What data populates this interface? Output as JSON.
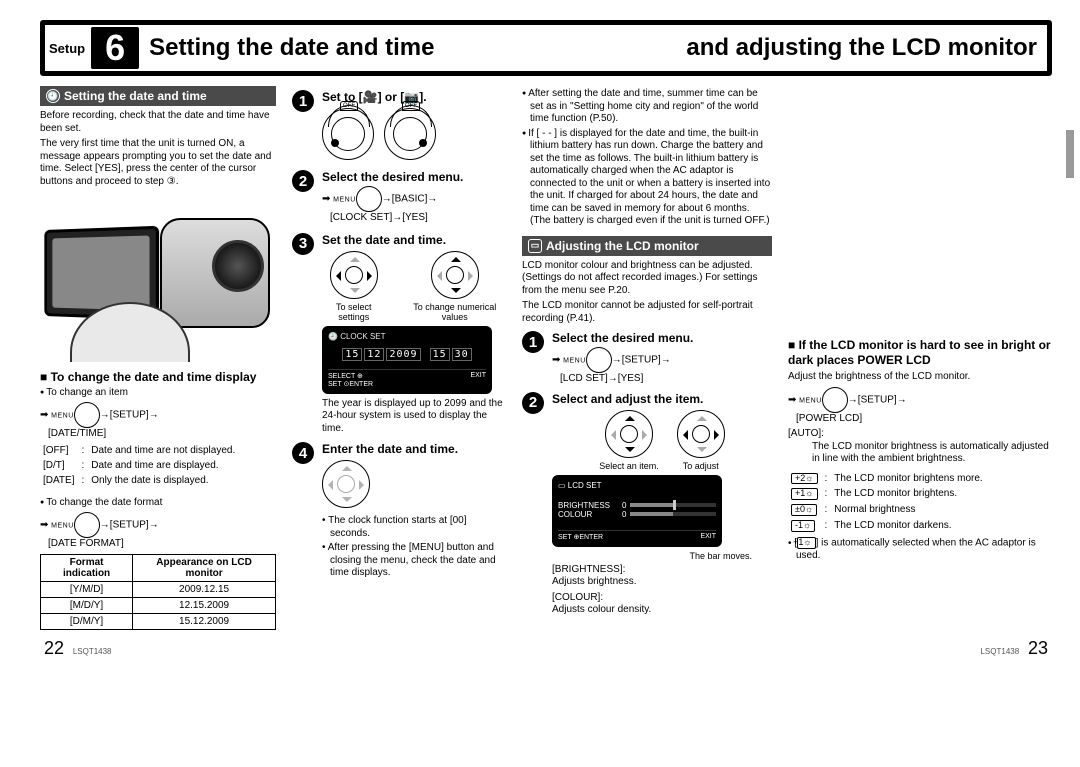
{
  "header": {
    "setup_label": "Setup",
    "step_number": "6",
    "title_left": "Setting the date and time",
    "title_right": "and adjusting the LCD monitor"
  },
  "section_datetime": {
    "bar_label": "Setting the date and time",
    "intro_1": "Before recording, check that the date and time have been set.",
    "intro_2": "The very first time that the unit is turned ON, a message appears prompting you to set the date and time. Select [YES], press the center of the cursor buttons and proceed to step ③.",
    "change_display_head": "To change the date and time display",
    "change_item": "To change an item",
    "menu_path_1a": "→[SETUP]→",
    "menu_path_1b": "[DATE/TIME]",
    "defs": [
      [
        "[OFF]",
        ":",
        "Date and time are not displayed."
      ],
      [
        "[D/T]",
        ":",
        "Date and time are displayed."
      ],
      [
        "[DATE]",
        ":",
        "Only the date is displayed."
      ]
    ],
    "change_format": "To change the date format",
    "menu_path_2a": "→[SETUP]→",
    "menu_path_2b": "[DATE FORMAT]",
    "table": {
      "h1": "Format indication",
      "h2": "Appearance on LCD monitor",
      "rows": [
        [
          "[Y/M/D]",
          "2009.12.15"
        ],
        [
          "[M/D/Y]",
          "12.15.2009"
        ],
        [
          "[D/M/Y]",
          "15.12.2009"
        ]
      ]
    }
  },
  "steps_dt": {
    "s1": "Set to [🎥] or [📷].",
    "s2": "Select the desired menu.",
    "s2_path_a": "→[BASIC]→",
    "s2_path_b": "[CLOCK SET]→[YES]",
    "s3": "Set the date and time.",
    "s3_cap_l": "To select settings",
    "s3_cap_r": "To change numerical values",
    "lcd1_title": "CLOCK SET",
    "lcd1_date": [
      "15",
      "12",
      "2009",
      "15",
      "30"
    ],
    "lcd1_b_l": "SELECT",
    "lcd1_b_c": "SET",
    "lcd1_b_r": "ENTER",
    "lcd1_b_exit": "EXIT",
    "s3_note": "The year is displayed up to 2099 and the 24-hour system is used to display the time.",
    "s4": "Enter the date and time.",
    "s4_n1": "The clock function starts at [00] seconds.",
    "s4_n2": "After pressing the [MENU] button and closing the menu, check the date and time displays."
  },
  "top_notes": {
    "n1": "After setting the date and time, summer time can be set as in \"Setting home city and region\" of the world time function (P.50).",
    "n2": "If [ - - ] is displayed for the date and time, the built-in lithium battery has run down. Charge the battery and set the time as follows. The built-in lithium battery is automatically charged when the AC adaptor is connected to the unit or when a battery is inserted into the unit. If charged for about 24 hours, the date and time can be saved in memory for about 6 months. (The battery is charged even if the unit is turned OFF.)"
  },
  "section_lcd": {
    "bar_label": "Adjusting the LCD monitor",
    "intro_1": "LCD monitor colour and brightness can be adjusted. (Settings do not affect recorded images.) For settings from the menu see P.20.",
    "intro_2": "The LCD monitor cannot be adjusted for self-portrait recording (P.41).",
    "s1": "Select the desired menu.",
    "s1_path_a": "→[SETUP]→",
    "s1_path_b": "[LCD SET]→[YES]",
    "s2": "Select and adjust the item.",
    "s2_cap_l": "Select an item.",
    "s2_cap_r": "To adjust",
    "lcd2_title": "LCD SET",
    "lcd2_row1": "BRIGHTNESS",
    "lcd2_row2": "COLOUR",
    "lcd2_b_l": "SET",
    "lcd2_b_c": "ENTER",
    "lcd2_b_r": "EXIT",
    "bar_caption": "The bar moves.",
    "brightness_label": "[BRIGHTNESS]:",
    "brightness_desc": "Adjusts brightness.",
    "colour_label": "[COLOUR]:",
    "colour_desc": "Adjusts colour density."
  },
  "power_lcd": {
    "head": "If the LCD monitor is hard to see in bright or dark places POWER LCD",
    "desc": "Adjust the brightness of the LCD monitor.",
    "path_a": "→[SETUP]→",
    "path_b": "[POWER LCD]",
    "auto_label": "[AUTO]:",
    "auto_desc": "The LCD monitor brightness is automatically adjusted in line with the ambient brightness.",
    "r_plus2": "The LCD monitor brightens more.",
    "r_plus1": "The LCD monitor brightens.",
    "r_0": "Normal brightness",
    "r_minus1": "The LCD monitor darkens.",
    "note": "is automatically selected when the AC adaptor is used."
  },
  "footer": {
    "left_page": "22",
    "right_page": "23",
    "code": "LSQT1438"
  }
}
